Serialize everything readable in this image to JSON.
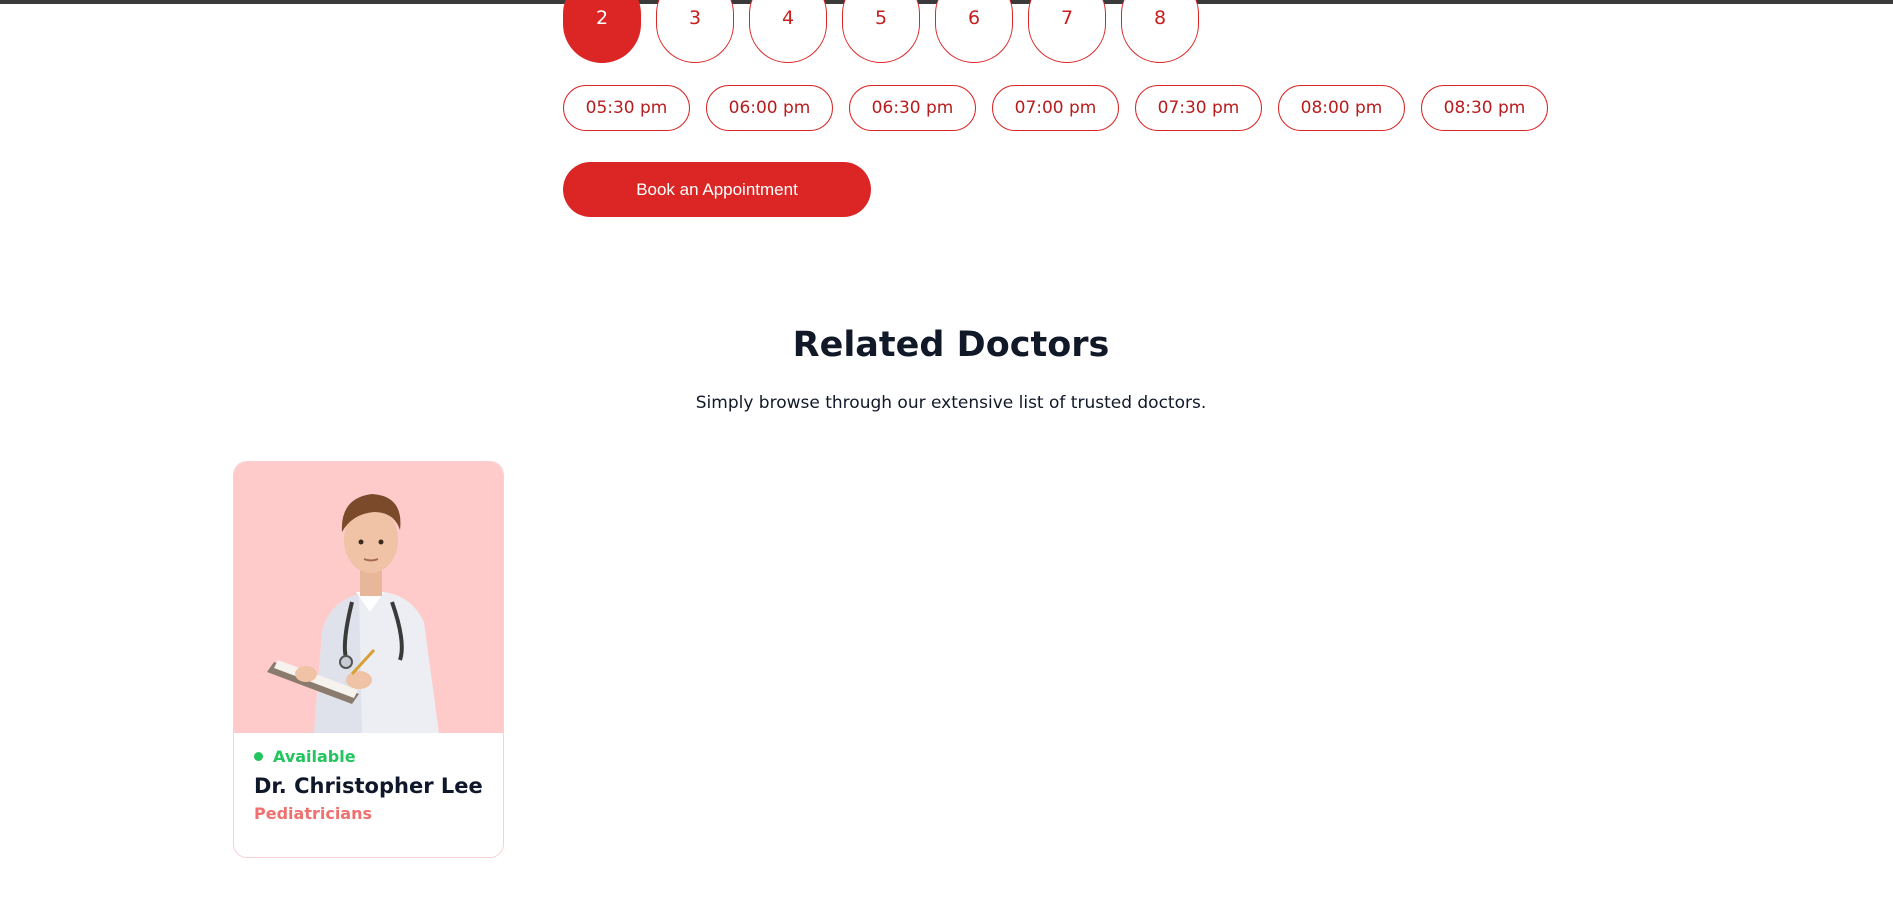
{
  "days": [
    "2",
    "3",
    "4",
    "5",
    "6",
    "7",
    "8"
  ],
  "active_day_index": 0,
  "time_slots": [
    "05:30 pm",
    "06:00 pm",
    "06:30 pm",
    "07:00 pm",
    "07:30 pm",
    "08:00 pm",
    "08:30 pm"
  ],
  "book_button_label": "Book an Appointment",
  "related": {
    "title": "Related Doctors",
    "subtitle": "Simply browse through our extensive list of trusted doctors."
  },
  "doctors": [
    {
      "status": "Available",
      "name": "Dr. Christopher Lee",
      "specialty": "Pediatricians"
    }
  ],
  "colors": {
    "accent": "#dc2626",
    "available": "#22c55e",
    "specialty": "#f07070",
    "card_bg": "#fecaca"
  }
}
